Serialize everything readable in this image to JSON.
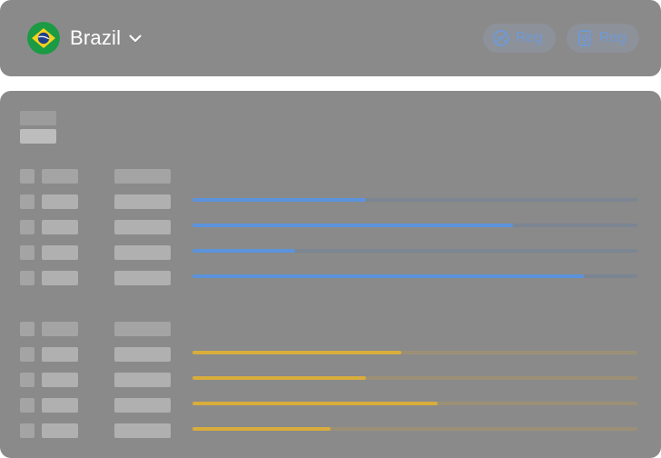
{
  "header": {
    "country": "Brazil",
    "flag_icon": "brazil-flag-icon",
    "dropdown_icon": "chevron-down-icon",
    "buttons": [
      {
        "label": "Reg",
        "icon": "dashed-circle-icon"
      },
      {
        "label": "Reg",
        "icon": "document-badge-icon"
      }
    ]
  },
  "colors": {
    "blue_fill": "#5b93dc",
    "blue_track": "#7c8592",
    "yellow_fill": "#d9ad3c",
    "yellow_track": "#9b9076"
  },
  "groups": [
    {
      "name": "blue",
      "rows": [
        0.39,
        0.72,
        0.23,
        0.88
      ]
    },
    {
      "name": "yellow",
      "rows": [
        0.47,
        0.39,
        0.55,
        0.31
      ]
    }
  ]
}
